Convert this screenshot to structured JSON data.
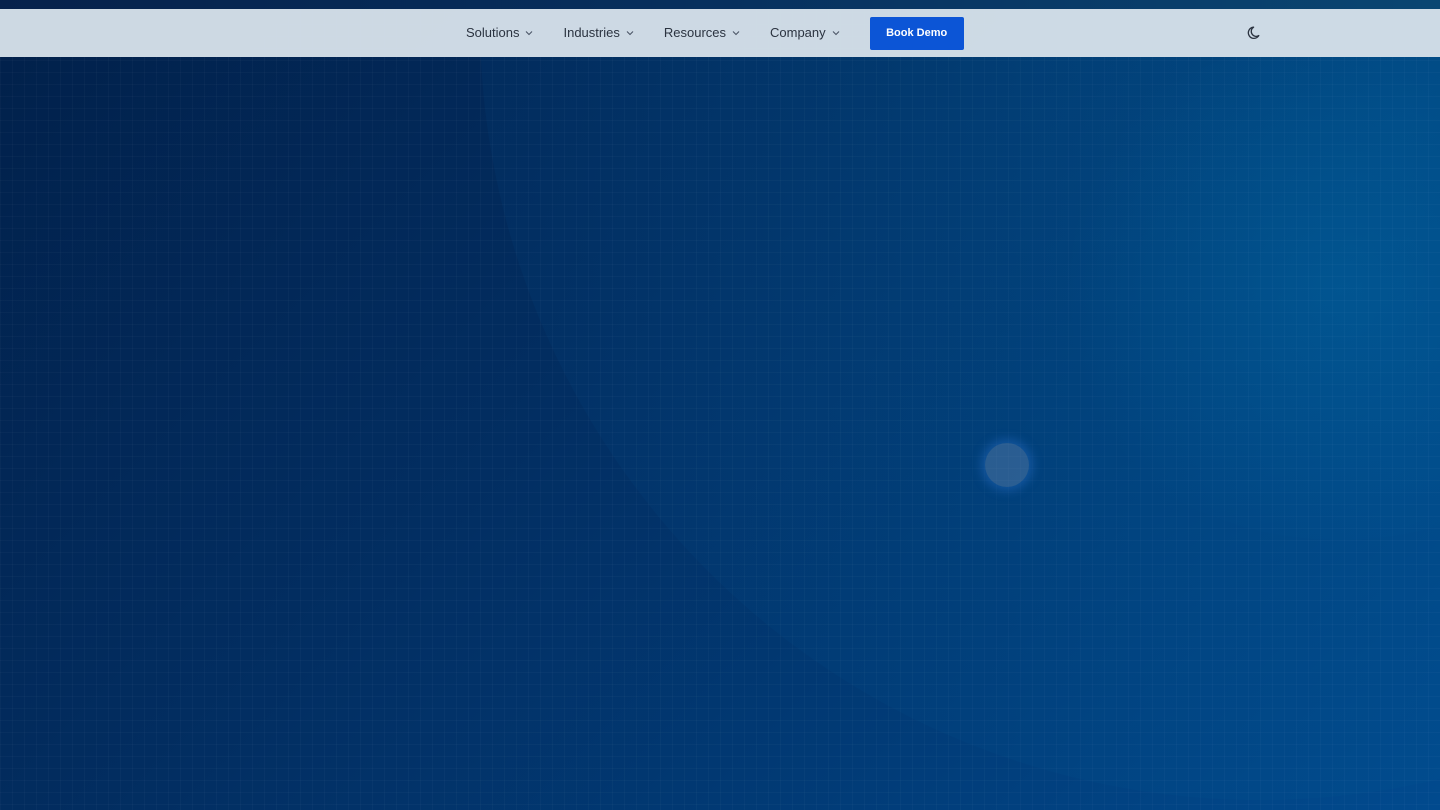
{
  "nav": {
    "items": [
      {
        "label": "Solutions",
        "icon": "chevron-down-icon"
      },
      {
        "label": "Industries",
        "icon": "chevron-down-icon"
      },
      {
        "label": "Resources",
        "icon": "chevron-down-icon"
      },
      {
        "label": "Company",
        "icon": "chevron-down-icon"
      }
    ],
    "cta_label": "Book Demo",
    "theme_icon": "moon-icon"
  },
  "colors": {
    "navbar_bg": "#d4dfe8",
    "cta_bg": "#0c55d6",
    "hero_bg_dark": "#01204a",
    "hero_bg_light": "#014a8e"
  }
}
